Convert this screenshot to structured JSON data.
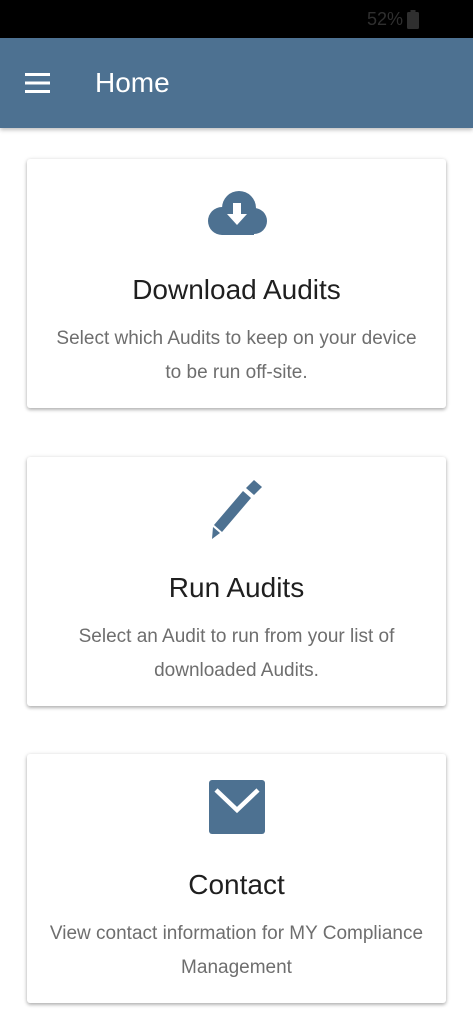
{
  "status_bar": {
    "battery_text": "52%",
    "battery_icon": "battery-icon"
  },
  "app_bar": {
    "menu_icon": "hamburger-menu-icon",
    "title": "Home",
    "color": "#4d7191"
  },
  "cards": [
    {
      "icon": "cloud-download-icon",
      "title": "Download Audits",
      "description": "Select which Audits to keep on your device to be run off-site."
    },
    {
      "icon": "pencil-icon",
      "title": "Run Audits",
      "description": "Select an Audit to run from your list of downloaded Audits."
    },
    {
      "icon": "envelope-icon",
      "title": "Contact",
      "description": "View contact information for MY Compliance Management"
    }
  ],
  "colors": {
    "accent": "#4d7191",
    "title_text": "#1f1f1f",
    "description_text": "#6e6e6e"
  }
}
